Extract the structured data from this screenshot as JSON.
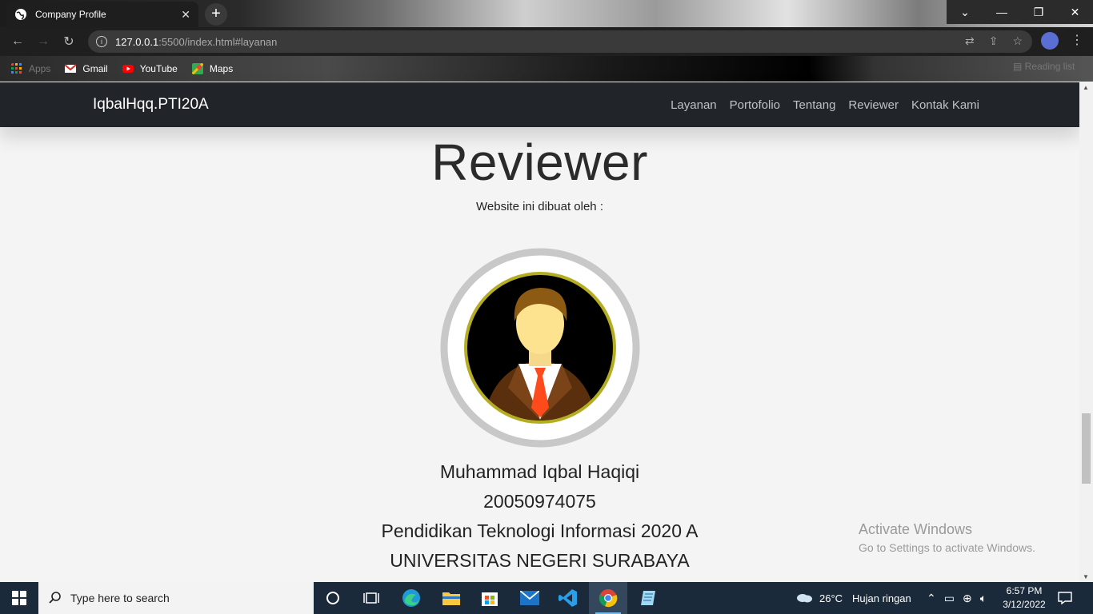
{
  "browser": {
    "tab_title": "Company Profile",
    "tab_close": "✕",
    "new_tab": "+",
    "url_host": "127.0.0.1",
    "url_rest": ":5500/index.html#layanan",
    "window_controls": {
      "tabsearch": "⌄",
      "minimize": "—",
      "restore": "❐",
      "close": "✕"
    },
    "bookmarks": [
      {
        "label": "Apps"
      },
      {
        "label": "Gmail"
      },
      {
        "label": "YouTube"
      },
      {
        "label": "Maps"
      }
    ],
    "reading_list": "Reading list"
  },
  "site": {
    "brand": "IqbalHqq.PTI20A",
    "menu": [
      "Layanan",
      "Portofolio",
      "Tentang",
      "Reviewer",
      "Kontak Kami"
    ],
    "section_title": "Reviewer",
    "section_subtitle": "Website ini dibuat oleh :",
    "person": {
      "name": "Muhammad Iqbal Haqiqi",
      "id": "20050974075",
      "program": "Pendidikan Teknologi Informasi 2020 A",
      "university": "UNIVERSITAS NEGERI SURABAYA"
    }
  },
  "watermark": {
    "line1": "Activate Windows",
    "line2": "Go to Settings to activate Windows."
  },
  "taskbar": {
    "search_placeholder": "Type here to search",
    "weather_temp": "26°C",
    "weather_text": "Hujan ringan",
    "time": "6:57 PM",
    "date": "3/12/2022"
  },
  "colors": {
    "navbar": "#212529",
    "page_bg": "#f4f4f4",
    "taskbar": "#1b2a3a",
    "brand_accent": "#ffffff"
  }
}
